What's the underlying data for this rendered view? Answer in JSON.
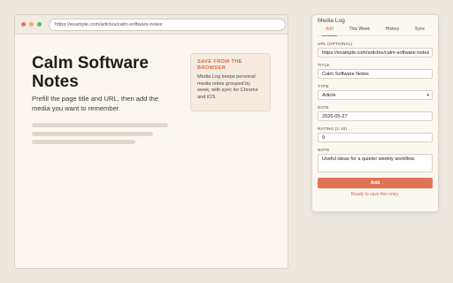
{
  "browser": {
    "url": "https://example.com/articles/calm-software-notes",
    "page_title": "Calm Software Notes",
    "page_subtitle": "Prefill the page title and URL, then add the media you want to remember."
  },
  "callout": {
    "heading": "Save from the browser",
    "body": "Media Log keeps personal media notes grouped by week, with sync for Chrome and iOS."
  },
  "popup": {
    "title": "Media Log",
    "tabs": [
      {
        "label": "Add",
        "active": true
      },
      {
        "label": "This Week",
        "active": false
      },
      {
        "label": "History",
        "active": false
      },
      {
        "label": "Sync",
        "active": false
      }
    ],
    "fields": {
      "url_label": "URL (optional)",
      "url_value": "https://example.com/articles/calm-software-notes",
      "title_label": "Title",
      "title_value": "Calm Software Notes",
      "type_label": "Type",
      "type_value": "Article",
      "date_label": "Date",
      "date_value": "2026-05-27",
      "rating_label": "Rating (1-10)",
      "rating_value": "9",
      "note_label": "Note",
      "note_value": "Useful ideas for a quieter weekly workflow."
    },
    "add_label": "Add",
    "status": "Ready to save this entry."
  },
  "colors": {
    "accent": "#df7452",
    "background": "#ede8df"
  }
}
